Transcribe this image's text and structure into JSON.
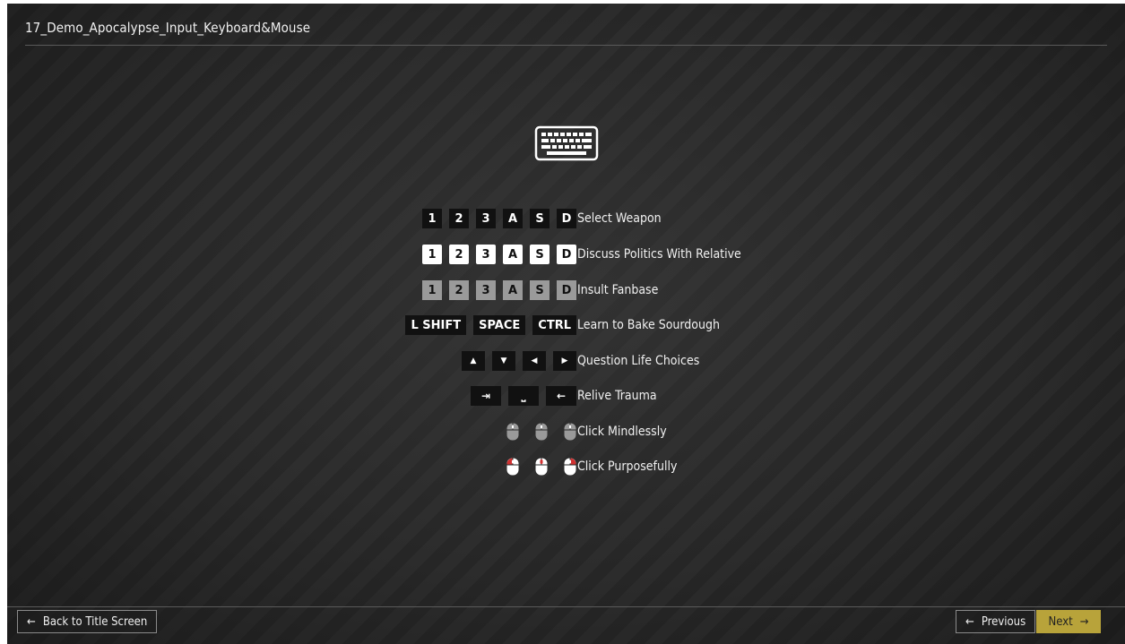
{
  "header": {
    "title": "17_Demo_Apocalypse_Input_Keyboard&Mouse"
  },
  "icons": {
    "keyboard": "keyboard-icon"
  },
  "rows": [
    {
      "keys": [
        "1",
        "2",
        "3",
        "A",
        "S",
        "D"
      ],
      "style": "dark",
      "label": "Select Weapon"
    },
    {
      "keys": [
        "1",
        "2",
        "3",
        "A",
        "S",
        "D"
      ],
      "style": "white",
      "label": "Discuss Politics With Relative"
    },
    {
      "keys": [
        "1",
        "2",
        "3",
        "A",
        "S",
        "D"
      ],
      "style": "gray",
      "label": "Insult Fanbase"
    },
    {
      "keys": [
        "L SHIFT",
        "SPACE",
        "CTRL"
      ],
      "style": "wide",
      "label": "Learn to Bake Sourdough"
    },
    {
      "keys": [
        "▲",
        "▼",
        "◀",
        "▶"
      ],
      "style": "arrow",
      "label": "Question Life Choices"
    },
    {
      "keys": [
        "⇥",
        "⎵",
        "←"
      ],
      "style": "special",
      "label": "Relive Trauma"
    },
    {
      "keys": [
        "left-mouse-icon",
        "middle-mouse-icon",
        "right-mouse-icon"
      ],
      "style": "mouse-gray",
      "label": "Click Mindlessly"
    },
    {
      "keys": [
        "left-mouse-icon",
        "middle-mouse-icon",
        "right-mouse-icon"
      ],
      "style": "mouse-red",
      "label": "Click Purposefully"
    }
  ],
  "footer": {
    "back_label": "Back to Title Screen",
    "prev_label": "Previous",
    "next_label": "Next",
    "next_color": "#b8a33a"
  }
}
